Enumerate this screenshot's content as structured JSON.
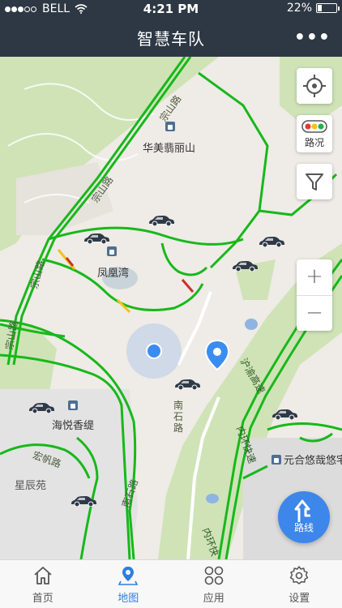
{
  "status_bar": {
    "carrier": "BELL",
    "time": "4:21 PM",
    "battery_percent": "22%",
    "battery_level": 0.22
  },
  "nav": {
    "title": "智慧车队",
    "more_label": "•••"
  },
  "map": {
    "pois": [
      {
        "key": "huamei",
        "label": "华美翡丽山"
      },
      {
        "key": "fenghuangwan",
        "label": "凤凰湾"
      },
      {
        "key": "haiyue",
        "label": "海悦香缇"
      },
      {
        "key": "yuanhe",
        "label": "元合悠哉悠宅"
      },
      {
        "key": "xingchen",
        "label": "星辰苑"
      }
    ],
    "road_labels": {
      "zongshan_1": "宗山路",
      "zongshan_2": "宗山路",
      "zongshan_3": "宗山路",
      "zongshan_4": "宗山路",
      "hongfan": "宏帆路",
      "nanshi_1": "南石路",
      "nanshi_2": "南石路",
      "shanghai_gaosu": "沪渝高速",
      "neihuan_1": "内环快速",
      "neihuan_2": "内环快"
    },
    "colors": {
      "road_green": "#17b81a",
      "road_yellow": "#f2c21b",
      "road_red": "#c9312b",
      "park": "#cfe3b7",
      "residential": "#e3e3e3",
      "location_dot": "#3b8cf0",
      "marker": "#3b8cf0",
      "car": "#2f3a48"
    }
  },
  "controls": {
    "traffic_label": "路况",
    "zoom_in": "+",
    "zoom_out": "−",
    "route_label": "路线"
  },
  "tabs": [
    {
      "label": "首页",
      "icon": "home-icon",
      "active": false
    },
    {
      "label": "地图",
      "icon": "map-pin-icon",
      "active": true
    },
    {
      "label": "应用",
      "icon": "apps-grid-icon",
      "active": false
    },
    {
      "label": "设置",
      "icon": "gear-icon",
      "active": false
    }
  ]
}
